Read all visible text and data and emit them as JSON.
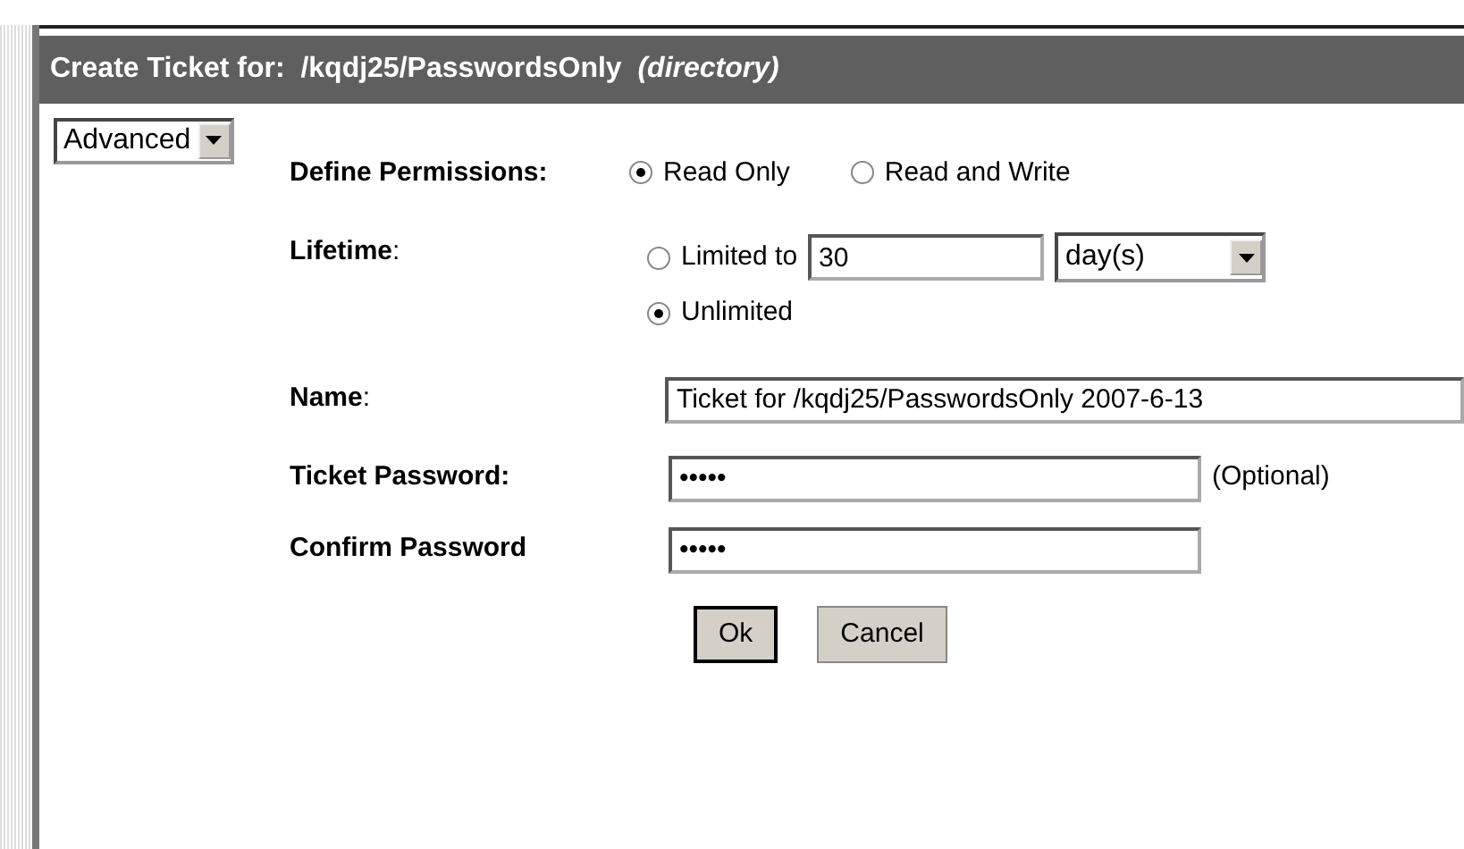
{
  "panel": {
    "title": "Create Ticket for:",
    "path": "/kqdj25/PasswordsOnly",
    "path_note": "(directory)"
  },
  "mode_select": {
    "value": "Advanced"
  },
  "permissions": {
    "label": "Define Permissions:",
    "options": [
      {
        "label": "Read Only",
        "selected": true
      },
      {
        "label": "Read and Write",
        "selected": false
      }
    ]
  },
  "lifetime": {
    "label": "Lifetime",
    "label_suffix": ":",
    "options": [
      {
        "label": "Limited to",
        "selected": false
      },
      {
        "label": "Unlimited",
        "selected": true
      }
    ],
    "amount": "30",
    "unit": "day(s)"
  },
  "name": {
    "label": "Name",
    "label_suffix": ":",
    "value": "Ticket for /kqdj25/PasswordsOnly 2007-6-13"
  },
  "ticket_password": {
    "label": "Ticket Password:",
    "value": "•••••",
    "note": "(Optional)"
  },
  "confirm_password": {
    "label": "Confirm Password",
    "value": "•••••"
  },
  "buttons": [
    {
      "label": "Ok",
      "default": true
    },
    {
      "label": "Cancel",
      "default": false
    }
  ]
}
